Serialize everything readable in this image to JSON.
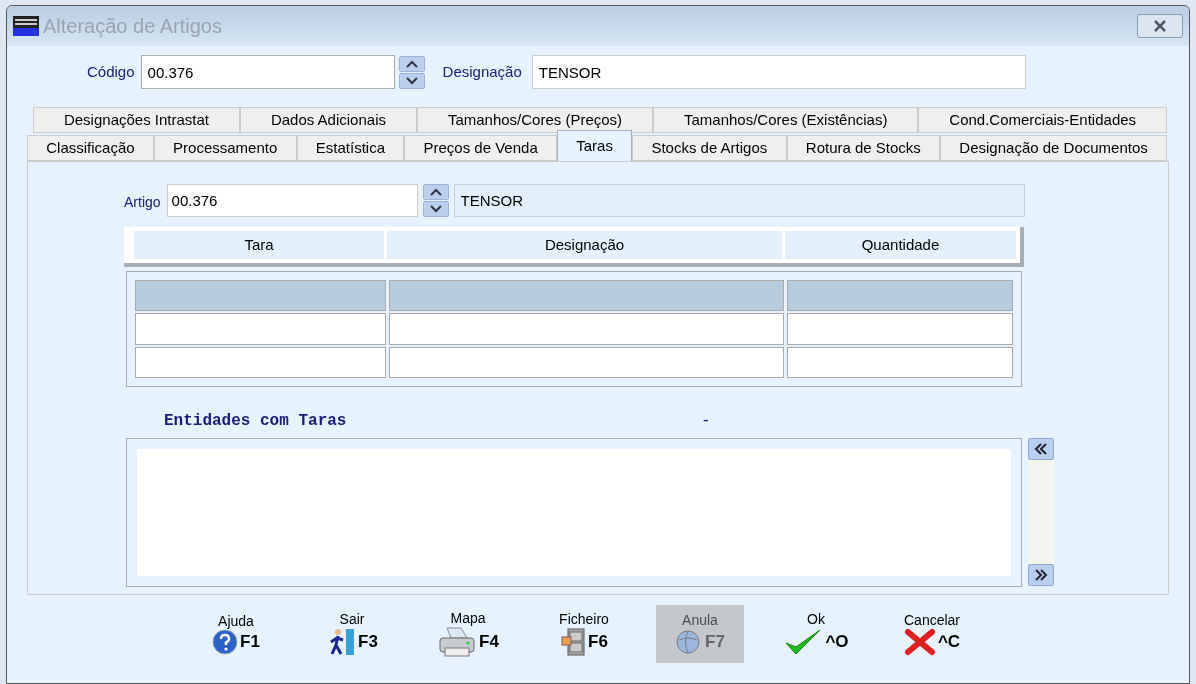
{
  "window": {
    "title": "Alteração de Artigos"
  },
  "header": {
    "code_label": "Código",
    "code_value": "00.376",
    "designation_label": "Designação",
    "designation_value": "TENSOR"
  },
  "tab_rows": [
    [
      {
        "label": "Designações Intrastat",
        "selected": false
      },
      {
        "label": "Dados Adicionais",
        "selected": false
      },
      {
        "label": "Tamanhos/Cores (Preços)",
        "selected": false
      },
      {
        "label": "Tamanhos/Cores (Existências)",
        "selected": false
      },
      {
        "label": "Cond.Comerciais-Entidades",
        "selected": false
      }
    ],
    [
      {
        "label": "Classificação",
        "selected": false
      },
      {
        "label": "Processamento",
        "selected": false
      },
      {
        "label": "Estatística",
        "selected": false
      },
      {
        "label": "Preços de Venda",
        "selected": false
      },
      {
        "label": "Taras",
        "selected": true
      },
      {
        "label": "Stocks de Artigos",
        "selected": false
      },
      {
        "label": "Rotura de Stocks",
        "selected": false
      },
      {
        "label": "Designação de Documentos",
        "selected": false
      }
    ]
  ],
  "article": {
    "label": "Artigo",
    "value": "00.376",
    "description": "TENSOR"
  },
  "table": {
    "columns": [
      "Tara",
      "Designação",
      "Quantidade"
    ],
    "rows": [
      {
        "selected": true
      },
      {
        "selected": false
      },
      {
        "selected": false
      }
    ]
  },
  "entities": {
    "title": "Entidades com Taras",
    "separator": "-"
  },
  "toolbar": [
    {
      "label": "Ajuda",
      "key": "F1",
      "kind": "help",
      "disabled": false
    },
    {
      "label": "Sair",
      "key": "F3",
      "kind": "exit",
      "disabled": false
    },
    {
      "label": "Mapa",
      "key": "F4",
      "kind": "print",
      "disabled": false
    },
    {
      "label": "Ficheiro",
      "key": "F6",
      "kind": "file",
      "disabled": false
    },
    {
      "label": "Anula",
      "key": "F7",
      "kind": "cancel-doc",
      "disabled": true
    },
    {
      "label": "Ok",
      "key": "^O",
      "kind": "ok",
      "disabled": false
    },
    {
      "label": "Cancelar",
      "key": "^C",
      "kind": "cancel",
      "disabled": false
    }
  ]
}
